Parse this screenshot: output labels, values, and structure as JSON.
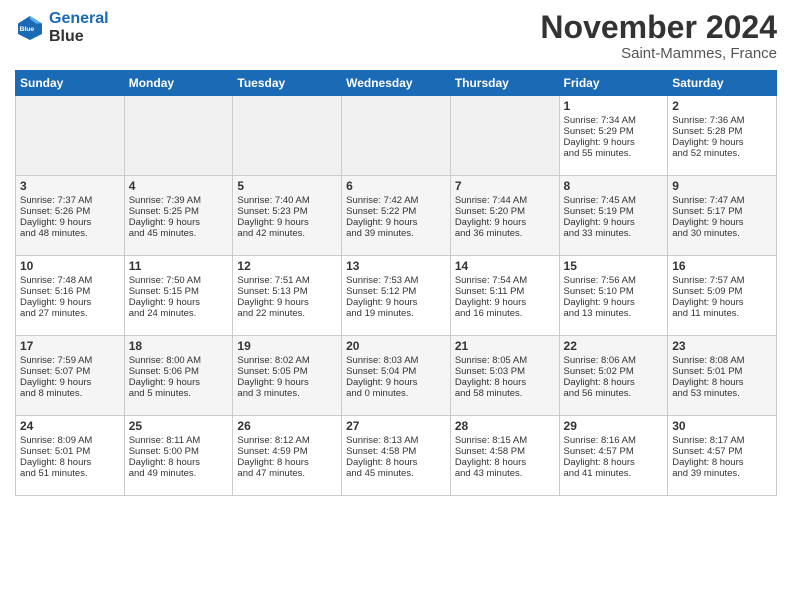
{
  "header": {
    "logo_line1": "General",
    "logo_line2": "Blue",
    "month_title": "November 2024",
    "location": "Saint-Mammes, France"
  },
  "columns": [
    "Sunday",
    "Monday",
    "Tuesday",
    "Wednesday",
    "Thursday",
    "Friday",
    "Saturday"
  ],
  "rows": [
    {
      "class": "row1",
      "cells": [
        {
          "empty": true
        },
        {
          "empty": true
        },
        {
          "empty": true
        },
        {
          "empty": true
        },
        {
          "empty": true
        },
        {
          "day": "1",
          "line1": "Sunrise: 7:34 AM",
          "line2": "Sunset: 5:29 PM",
          "line3": "Daylight: 9 hours",
          "line4": "and 55 minutes."
        },
        {
          "day": "2",
          "line1": "Sunrise: 7:36 AM",
          "line2": "Sunset: 5:28 PM",
          "line3": "Daylight: 9 hours",
          "line4": "and 52 minutes."
        }
      ]
    },
    {
      "class": "row2",
      "cells": [
        {
          "day": "3",
          "line1": "Sunrise: 7:37 AM",
          "line2": "Sunset: 5:26 PM",
          "line3": "Daylight: 9 hours",
          "line4": "and 48 minutes."
        },
        {
          "day": "4",
          "line1": "Sunrise: 7:39 AM",
          "line2": "Sunset: 5:25 PM",
          "line3": "Daylight: 9 hours",
          "line4": "and 45 minutes."
        },
        {
          "day": "5",
          "line1": "Sunrise: 7:40 AM",
          "line2": "Sunset: 5:23 PM",
          "line3": "Daylight: 9 hours",
          "line4": "and 42 minutes."
        },
        {
          "day": "6",
          "line1": "Sunrise: 7:42 AM",
          "line2": "Sunset: 5:22 PM",
          "line3": "Daylight: 9 hours",
          "line4": "and 39 minutes."
        },
        {
          "day": "7",
          "line1": "Sunrise: 7:44 AM",
          "line2": "Sunset: 5:20 PM",
          "line3": "Daylight: 9 hours",
          "line4": "and 36 minutes."
        },
        {
          "day": "8",
          "line1": "Sunrise: 7:45 AM",
          "line2": "Sunset: 5:19 PM",
          "line3": "Daylight: 9 hours",
          "line4": "and 33 minutes."
        },
        {
          "day": "9",
          "line1": "Sunrise: 7:47 AM",
          "line2": "Sunset: 5:17 PM",
          "line3": "Daylight: 9 hours",
          "line4": "and 30 minutes."
        }
      ]
    },
    {
      "class": "row3",
      "cells": [
        {
          "day": "10",
          "line1": "Sunrise: 7:48 AM",
          "line2": "Sunset: 5:16 PM",
          "line3": "Daylight: 9 hours",
          "line4": "and 27 minutes."
        },
        {
          "day": "11",
          "line1": "Sunrise: 7:50 AM",
          "line2": "Sunset: 5:15 PM",
          "line3": "Daylight: 9 hours",
          "line4": "and 24 minutes."
        },
        {
          "day": "12",
          "line1": "Sunrise: 7:51 AM",
          "line2": "Sunset: 5:13 PM",
          "line3": "Daylight: 9 hours",
          "line4": "and 22 minutes."
        },
        {
          "day": "13",
          "line1": "Sunrise: 7:53 AM",
          "line2": "Sunset: 5:12 PM",
          "line3": "Daylight: 9 hours",
          "line4": "and 19 minutes."
        },
        {
          "day": "14",
          "line1": "Sunrise: 7:54 AM",
          "line2": "Sunset: 5:11 PM",
          "line3": "Daylight: 9 hours",
          "line4": "and 16 minutes."
        },
        {
          "day": "15",
          "line1": "Sunrise: 7:56 AM",
          "line2": "Sunset: 5:10 PM",
          "line3": "Daylight: 9 hours",
          "line4": "and 13 minutes."
        },
        {
          "day": "16",
          "line1": "Sunrise: 7:57 AM",
          "line2": "Sunset: 5:09 PM",
          "line3": "Daylight: 9 hours",
          "line4": "and 11 minutes."
        }
      ]
    },
    {
      "class": "row4",
      "cells": [
        {
          "day": "17",
          "line1": "Sunrise: 7:59 AM",
          "line2": "Sunset: 5:07 PM",
          "line3": "Daylight: 9 hours",
          "line4": "and 8 minutes."
        },
        {
          "day": "18",
          "line1": "Sunrise: 8:00 AM",
          "line2": "Sunset: 5:06 PM",
          "line3": "Daylight: 9 hours",
          "line4": "and 5 minutes."
        },
        {
          "day": "19",
          "line1": "Sunrise: 8:02 AM",
          "line2": "Sunset: 5:05 PM",
          "line3": "Daylight: 9 hours",
          "line4": "and 3 minutes."
        },
        {
          "day": "20",
          "line1": "Sunrise: 8:03 AM",
          "line2": "Sunset: 5:04 PM",
          "line3": "Daylight: 9 hours",
          "line4": "and 0 minutes."
        },
        {
          "day": "21",
          "line1": "Sunrise: 8:05 AM",
          "line2": "Sunset: 5:03 PM",
          "line3": "Daylight: 8 hours",
          "line4": "and 58 minutes."
        },
        {
          "day": "22",
          "line1": "Sunrise: 8:06 AM",
          "line2": "Sunset: 5:02 PM",
          "line3": "Daylight: 8 hours",
          "line4": "and 56 minutes."
        },
        {
          "day": "23",
          "line1": "Sunrise: 8:08 AM",
          "line2": "Sunset: 5:01 PM",
          "line3": "Daylight: 8 hours",
          "line4": "and 53 minutes."
        }
      ]
    },
    {
      "class": "row5",
      "cells": [
        {
          "day": "24",
          "line1": "Sunrise: 8:09 AM",
          "line2": "Sunset: 5:01 PM",
          "line3": "Daylight: 8 hours",
          "line4": "and 51 minutes."
        },
        {
          "day": "25",
          "line1": "Sunrise: 8:11 AM",
          "line2": "Sunset: 5:00 PM",
          "line3": "Daylight: 8 hours",
          "line4": "and 49 minutes."
        },
        {
          "day": "26",
          "line1": "Sunrise: 8:12 AM",
          "line2": "Sunset: 4:59 PM",
          "line3": "Daylight: 8 hours",
          "line4": "and 47 minutes."
        },
        {
          "day": "27",
          "line1": "Sunrise: 8:13 AM",
          "line2": "Sunset: 4:58 PM",
          "line3": "Daylight: 8 hours",
          "line4": "and 45 minutes."
        },
        {
          "day": "28",
          "line1": "Sunrise: 8:15 AM",
          "line2": "Sunset: 4:58 PM",
          "line3": "Daylight: 8 hours",
          "line4": "and 43 minutes."
        },
        {
          "day": "29",
          "line1": "Sunrise: 8:16 AM",
          "line2": "Sunset: 4:57 PM",
          "line3": "Daylight: 8 hours",
          "line4": "and 41 minutes."
        },
        {
          "day": "30",
          "line1": "Sunrise: 8:17 AM",
          "line2": "Sunset: 4:57 PM",
          "line3": "Daylight: 8 hours",
          "line4": "and 39 minutes."
        }
      ]
    }
  ]
}
